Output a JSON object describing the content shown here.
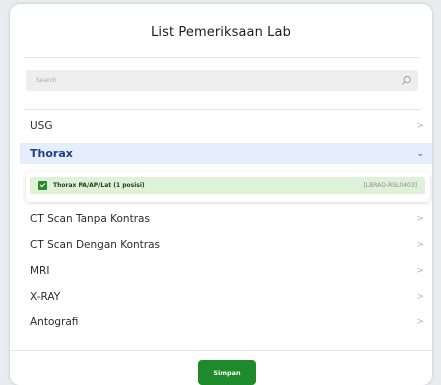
{
  "dialog": {
    "title": "List Pemeriksaan Lab"
  },
  "search": {
    "placeholder": "Search",
    "icon": "search-icon"
  },
  "categories": [
    {
      "label": "USG",
      "chevron": ">"
    },
    {
      "label": "Thorax",
      "chevron": "⌄",
      "expanded": true
    },
    {
      "label": "CT Scan Tanpa Kontras",
      "chevron": ">"
    },
    {
      "label": "CT Scan Dengan Kontras",
      "chevron": ">"
    },
    {
      "label": "MRI",
      "chevron": ">"
    },
    {
      "label": "X-RAY",
      "chevron": ">"
    },
    {
      "label": "Antografi",
      "chevron": ">"
    }
  ],
  "thorax_items": [
    {
      "label": "Thorax PA/AP/Lat (1 posisi)",
      "code": "[LBRAD-RSL0403]",
      "checked": true
    }
  ],
  "footer": {
    "save_label": "Simpan"
  },
  "colors": {
    "accent_green": "#1f8a2b",
    "selected_item_bg": "#dff1d8",
    "expanded_row_bg": "#e6edfb",
    "expanded_row_text": "#1f3f8f"
  }
}
